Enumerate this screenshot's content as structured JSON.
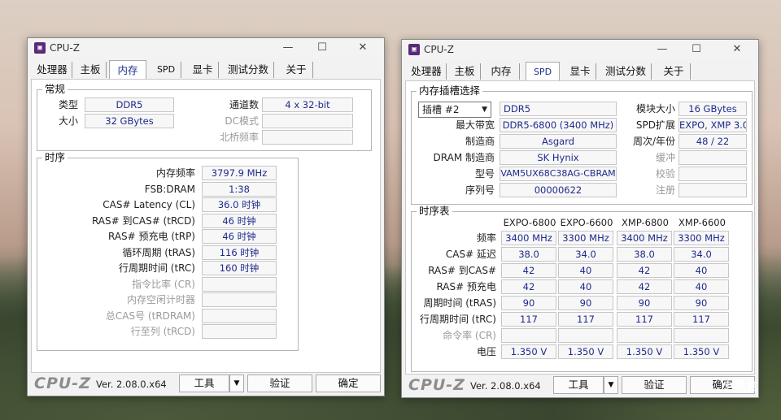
{
  "left": {
    "title": "CPU-Z",
    "tabs": [
      "处理器",
      "主板",
      "内存",
      "SPD",
      "显卡",
      "测试分数",
      "关于"
    ],
    "general": {
      "group": "常规",
      "type_label": "类型",
      "type_value": "DDR5",
      "size_label": "大小",
      "size_value": "32 GBytes",
      "channels_label": "通道数",
      "channels_value": "4 x 32-bit",
      "dc_label": "DC模式",
      "dc_value": "",
      "nb_label": "北桥频率",
      "nb_value": ""
    },
    "timing": {
      "group": "时序",
      "rows": [
        {
          "label": "内存频率",
          "value": "3797.9 MHz",
          "dim": false
        },
        {
          "label": "FSB:DRAM",
          "value": "1:38",
          "dim": false
        },
        {
          "label": "CAS# Latency (CL)",
          "value": "36.0 时钟",
          "dim": false
        },
        {
          "label": "RAS# 到CAS# (tRCD)",
          "value": "46 时钟",
          "dim": false
        },
        {
          "label": "RAS# 预充电 (tRP)",
          "value": "46 时钟",
          "dim": false
        },
        {
          "label": "循环周期 (tRAS)",
          "value": "116 时钟",
          "dim": false
        },
        {
          "label": "行周期时间 (tRC)",
          "value": "160 时钟",
          "dim": false
        },
        {
          "label": "指令比率 (CR)",
          "value": "",
          "dim": true
        },
        {
          "label": "内存空闲计时器",
          "value": "",
          "dim": true
        },
        {
          "label": "总CAS号 (tRDRAM)",
          "value": "",
          "dim": true
        },
        {
          "label": "行至列 (tRCD)",
          "value": "",
          "dim": true
        }
      ]
    },
    "footer": {
      "logo": "CPU-Z",
      "version": "Ver. 2.08.0.x64",
      "tools": "工具",
      "validate": "验证",
      "ok": "确定"
    }
  },
  "right": {
    "title": "CPU-Z",
    "tabs": [
      "处理器",
      "主板",
      "内存",
      "SPD",
      "显卡",
      "测试分数",
      "关于"
    ],
    "slot": {
      "group": "内存插槽选择",
      "slot_value": "插槽 #2",
      "type_value": "DDR5",
      "module_size_label": "模块大小",
      "module_size_value": "16 GBytes",
      "max_bw_label": "最大带宽",
      "max_bw_value": "DDR5-6800 (3400 MHz)",
      "spd_ext_label": "SPD扩展",
      "spd_ext_value": "EXPO, XMP 3.0",
      "mfr_label": "制造商",
      "mfr_value": "Asgard",
      "week_year_label": "周次/年份",
      "week_year_value": "48 / 22",
      "dram_mfr_label": "DRAM 制造商",
      "dram_mfr_value": "SK Hynix",
      "buffered_label": "缓冲",
      "buffered_value": "",
      "part_label": "型号",
      "part_value": "VAM5UX68C38AG-CBRAM",
      "corr_label": "校验",
      "corr_value": "",
      "serial_label": "序列号",
      "serial_value": "00000622",
      "reg_label": "注册",
      "reg_value": ""
    },
    "timing_table": {
      "group": "时序表",
      "columns": [
        "EXPO-6800",
        "EXPO-6600",
        "XMP-6800",
        "XMP-6600"
      ],
      "rows": [
        {
          "label": "频率",
          "values": [
            "3400 MHz",
            "3300 MHz",
            "3400 MHz",
            "3300 MHz"
          ],
          "dim": false
        },
        {
          "label": "CAS# 延迟",
          "values": [
            "38.0",
            "34.0",
            "38.0",
            "34.0"
          ],
          "dim": false
        },
        {
          "label": "RAS# 到CAS#",
          "values": [
            "42",
            "40",
            "42",
            "40"
          ],
          "dim": false
        },
        {
          "label": "RAS# 预充电",
          "values": [
            "42",
            "40",
            "42",
            "40"
          ],
          "dim": false
        },
        {
          "label": "周期时间 (tRAS)",
          "values": [
            "90",
            "90",
            "90",
            "90"
          ],
          "dim": false
        },
        {
          "label": "行周期时间 (tRC)",
          "values": [
            "117",
            "117",
            "117",
            "117"
          ],
          "dim": false
        },
        {
          "label": "命令率 (CR)",
          "values": [
            "",
            "",
            "",
            ""
          ],
          "dim": true
        },
        {
          "label": "电压",
          "values": [
            "1.350 V",
            "1.350 V",
            "1.350 V",
            "1.350 V"
          ],
          "dim": false
        }
      ]
    },
    "footer": {
      "logo": "CPU-Z",
      "version": "Ver. 2.08.0.x64",
      "tools": "工具",
      "validate": "验证",
      "ok": "确定"
    }
  },
  "watermark": "小黑盒"
}
